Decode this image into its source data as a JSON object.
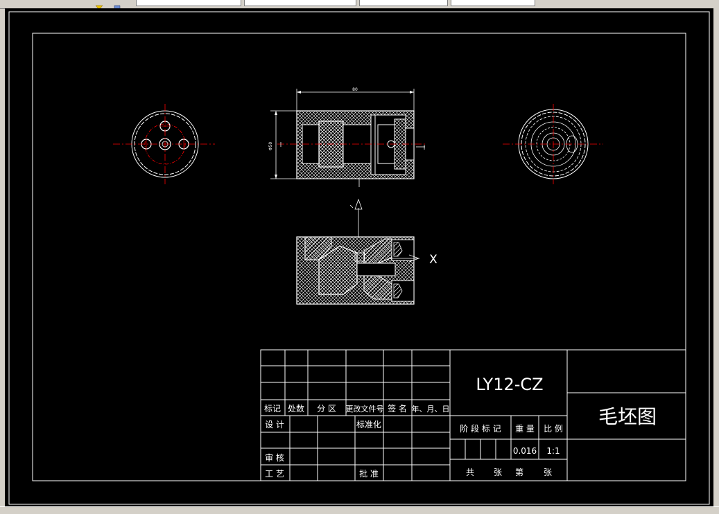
{
  "window": {
    "toolbar_fields": [
      "",
      "",
      "",
      ""
    ],
    "icons": [
      "layer-state-icon",
      "layer-properties-icon"
    ]
  },
  "drawing": {
    "part_code": "LY12-CZ",
    "drawing_title": "毛坯图",
    "dimension_top": "80",
    "dimension_left": "Φ50",
    "section_mark": "X",
    "title_block": {
      "row_labels": [
        "标记",
        "处数",
        "分 区",
        "更改文件号",
        "签 名",
        "年、月、日"
      ],
      "design": "设 计",
      "standardization": "标准化",
      "review": "审 核",
      "process": "工 艺",
      "approve": "批 准",
      "stage_mark": "阶 段 标 记",
      "weight_label": "重 量",
      "scale_label": "比 例",
      "weight_value": "0.016",
      "scale_value": "1:1",
      "sheet_total": "共",
      "sheet_unit_1": "张",
      "sheet_no": "第",
      "sheet_unit_2": "张"
    }
  },
  "colors": {
    "background": "#000000",
    "lines": "#ffffff",
    "centerline": "#ff0000"
  }
}
